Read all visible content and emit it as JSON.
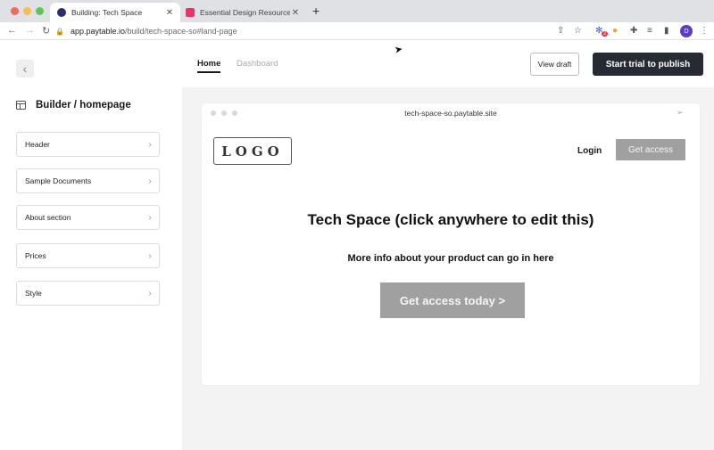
{
  "browser": {
    "tabs": [
      {
        "title": "Building: Tech Space",
        "active": true
      },
      {
        "title": "Essential Design Resources - D",
        "active": false
      }
    ],
    "close_glyph": "✕",
    "new_tab_glyph": "+",
    "url_host": "app.paytable.io",
    "url_path": "/build/tech-space-so#land-page",
    "profile_initial": "D",
    "extension_badge": "2"
  },
  "header": {
    "nav_tabs": [
      {
        "label": "Home",
        "active": true
      },
      {
        "label": "Dashboard",
        "active": false
      }
    ],
    "view_draft_label": "View draft",
    "start_trial_label": "Start trial to publish"
  },
  "sidebar": {
    "title": "Builder / homepage",
    "items": [
      {
        "label": "Header"
      },
      {
        "label": "Sample Documents"
      },
      {
        "label": "About section"
      },
      {
        "label": "Prices"
      },
      {
        "label": "Style"
      }
    ]
  },
  "preview": {
    "site_url": "tech-space-so.paytable.site",
    "logo_text": "LOGO",
    "login_label": "Login",
    "get_access_label": "Get access",
    "headline": "Tech Space (click anywhere to edit this)",
    "subheadline": "More info about your product can go in here",
    "cta_label": "Get access today >"
  },
  "colors": {
    "primary_button": "#252a33",
    "placeholder_button": "#a0a0a0",
    "canvas_bg": "#f3f3f4",
    "profile": "#5b3cc4"
  }
}
